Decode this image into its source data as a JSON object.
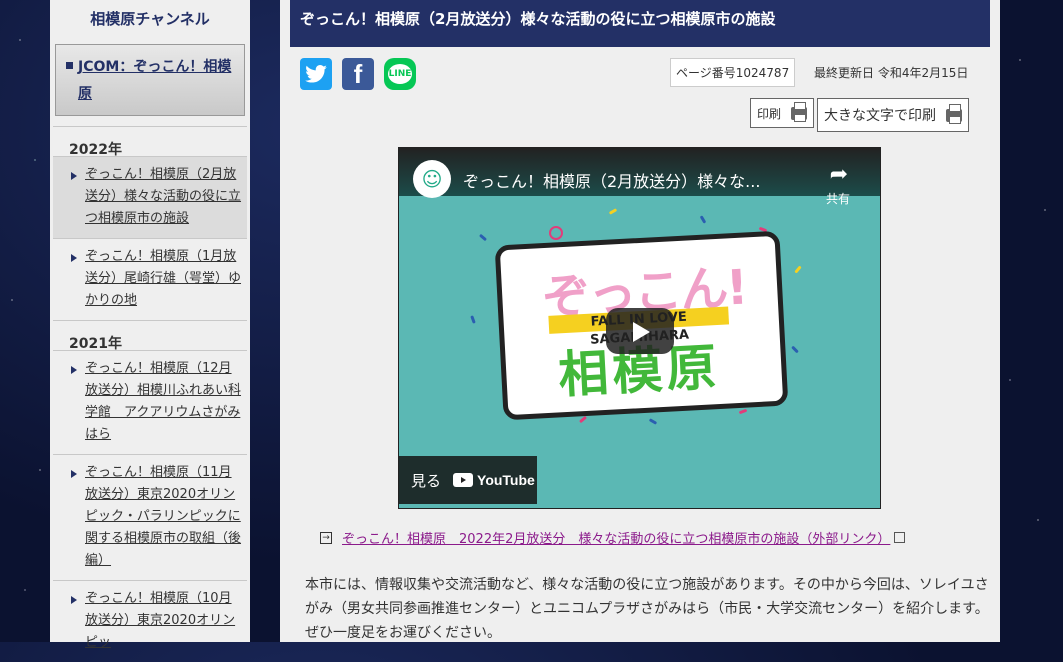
{
  "sidebar": {
    "title": "相模原チャンネル",
    "current": "JCOM：ぞっこん！相模原",
    "year_2022": "2022年",
    "items_2022": [
      "ぞっこん！相模原（2月放送分）様々な活動の役に立つ相模原市の施設",
      "ぞっこん！相模原（1月放送分）尾崎行雄（咢堂）ゆかりの地"
    ],
    "year_2021": "2021年",
    "items_2021": [
      "ぞっこん！相模原（12月放送分）相模川ふれあい科学館　アクアリウムさがみはら",
      "ぞっこん！相模原（11月放送分）東京2020オリンピック・パラリンピックに関する相模原市の取組（後編）",
      "ぞっこん！相模原（10月放送分）東京2020オリンピッ"
    ]
  },
  "main": {
    "title": "ぞっこん！相模原（2月放送分）様々な活動の役に立つ相模原市の施設",
    "page_number": "ページ番号1024787",
    "updated": "最終更新日 令和4年2月15日",
    "print_label": "印刷",
    "print_large_label": "大きな文字で印刷",
    "video": {
      "title": "ぞっこん！相模原（2月放送分）様々な...",
      "share_label": "共有",
      "logo_top": "ぞっこん!",
      "logo_band": "FALL IN LOVE SAGAMIHARA",
      "logo_bottom": "相模原",
      "watch_label": "見る",
      "youtube_label": "YouTube"
    },
    "external_link": "ぞっこん！相模原　2022年2月放送分　様々な活動の役に立つ相模原市の施設（外部リンク）",
    "body_text": "本市には、情報収集や交流活動など、様々な活動の役に立つ施設があります。その中から今回は、ソレイユさがみ（男女共同参画推進センター）とユニコムプラザさがみはら（市民・大学交流センター）を紹介します。ぜひ一度足をお運びください。"
  },
  "colors": {
    "navy": "#233066",
    "twitter": "#1da1f2",
    "facebook": "#3b5998",
    "line": "#06c755",
    "video_bg": "#5bb8b4",
    "link_visited": "#8b1a8b"
  },
  "icons": [
    "twitter-icon",
    "facebook-icon",
    "line-icon",
    "printer-icon",
    "share-icon",
    "play-icon",
    "youtube-icon",
    "external-link-icon"
  ]
}
